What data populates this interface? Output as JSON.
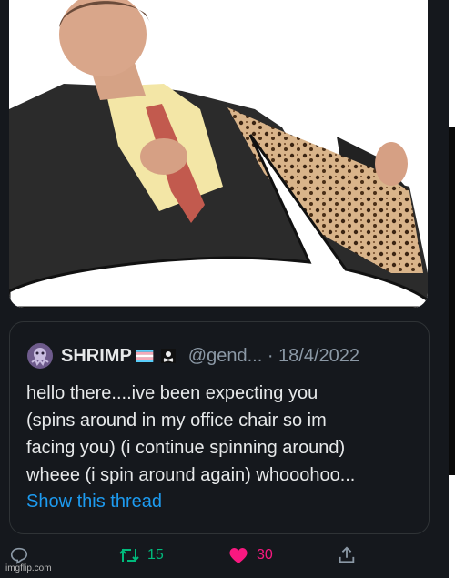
{
  "tweet": {
    "display_name": "SHRIMP",
    "handle_time": "@gend... · 18/4/2022",
    "text_lines": [
      "hello there....ive been expecting you",
      "(spins around in my office chair so im",
      "facing you) (i continue spinning around)",
      "wheee (i spin around again) whooohoo..."
    ],
    "show_thread": "Show this thread"
  },
  "actions": {
    "reply_icon": "speech-bubble-icon",
    "retweet_icon": "retweet-icon",
    "retweets": "15",
    "like_icon": "heart-icon",
    "likes": "30",
    "share_icon": "share-icon"
  },
  "watermark": "imgflip.com",
  "colors": {
    "background": "#15181d",
    "text": "#e7e9ea",
    "muted": "#8b98a5",
    "link": "#1d9bf0",
    "retweet": "#00ba7c",
    "like": "#f91880"
  }
}
